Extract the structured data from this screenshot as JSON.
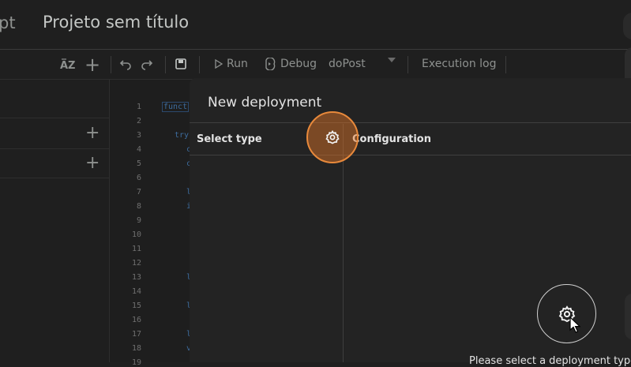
{
  "header": {
    "brand_tail": "pt",
    "project_title": "Projeto sem título"
  },
  "toolbar": {
    "run_label": "Run",
    "debug_label": "Debug",
    "function_select": "doPost",
    "execution_log_label": "Execution log"
  },
  "editor": {
    "line_numbers": [
      "1",
      "2",
      "3",
      "4",
      "5",
      "6",
      "7",
      "8",
      "9",
      "10",
      "11",
      "12",
      "13",
      "14",
      "15",
      "16",
      "17",
      "18",
      "19"
    ],
    "code_fragments": [
      "funct",
      "try",
      "c",
      "c",
      "l",
      "i",
      "l",
      "l",
      "l",
      "v"
    ]
  },
  "dialog": {
    "title": "New deployment",
    "select_type_label": "Select type",
    "configuration_label": "Configuration",
    "hint_text": "Please select a deployment type"
  },
  "colors": {
    "highlight": "#e8893b",
    "background": "#1f1f1f",
    "dialog_bg": "#232323"
  },
  "icons": [
    "sort-az-icon",
    "plus-icon",
    "undo-icon",
    "redo-icon",
    "save-icon",
    "play-icon",
    "debug-icon",
    "dropdown-arrow-icon",
    "gear-icon",
    "cursor-icon"
  ]
}
